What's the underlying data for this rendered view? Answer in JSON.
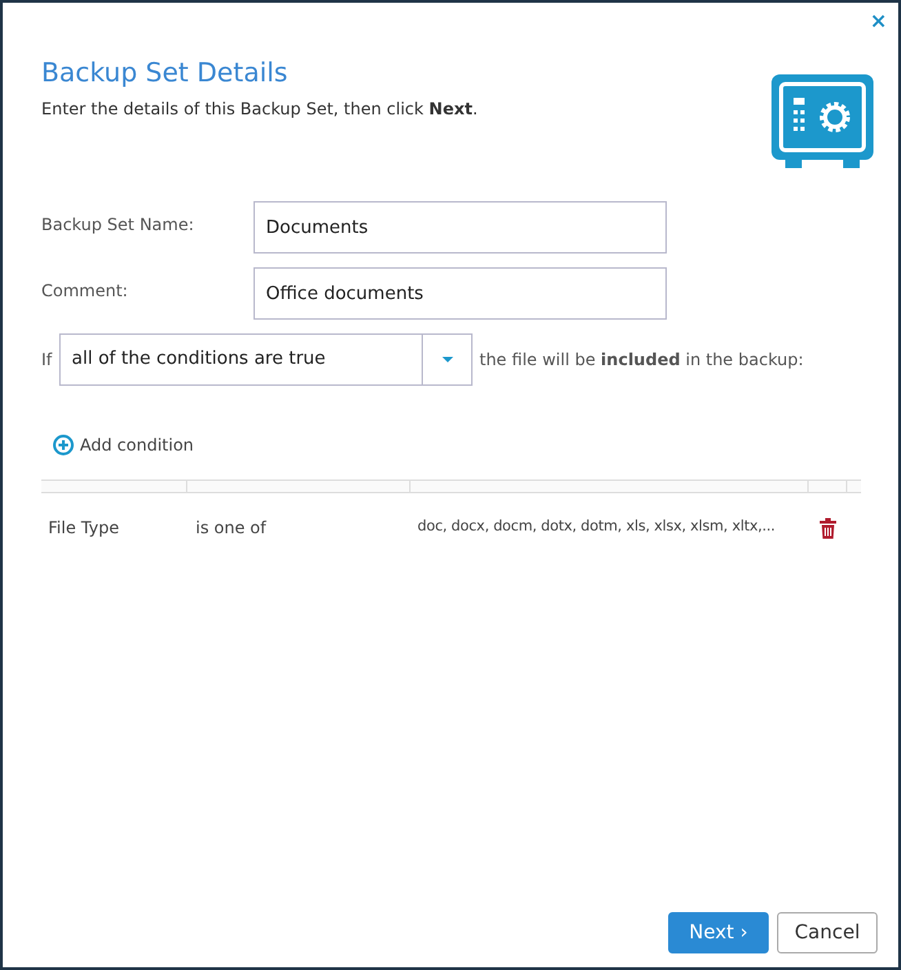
{
  "dialog": {
    "title": "Backup Set Details",
    "subtitle": "Enter the details of this Backup Set, then click **Next**.",
    "close": "×"
  },
  "fields": [
    {
      "label": "Backup Set Name:",
      "value": "Documents"
    },
    {
      "label": "Comment:",
      "value": "Office documents"
    }
  ],
  "rule": {
    "prefix": "If",
    "selection": "all of the conditions are true",
    "suffix": "the file will be **included** in the backup:"
  },
  "add_condition": "Add condition",
  "conditions": [
    {
      "field": "File Type",
      "operator": "is one of",
      "value": "doc, docx, docm, dotx, dotm, xls, xlsx, xlsm, xltx,..."
    }
  ],
  "buttons": [
    {
      "label": "Next ›",
      "kind": "primary"
    },
    {
      "label": "Cancel",
      "kind": "secondary"
    }
  ]
}
